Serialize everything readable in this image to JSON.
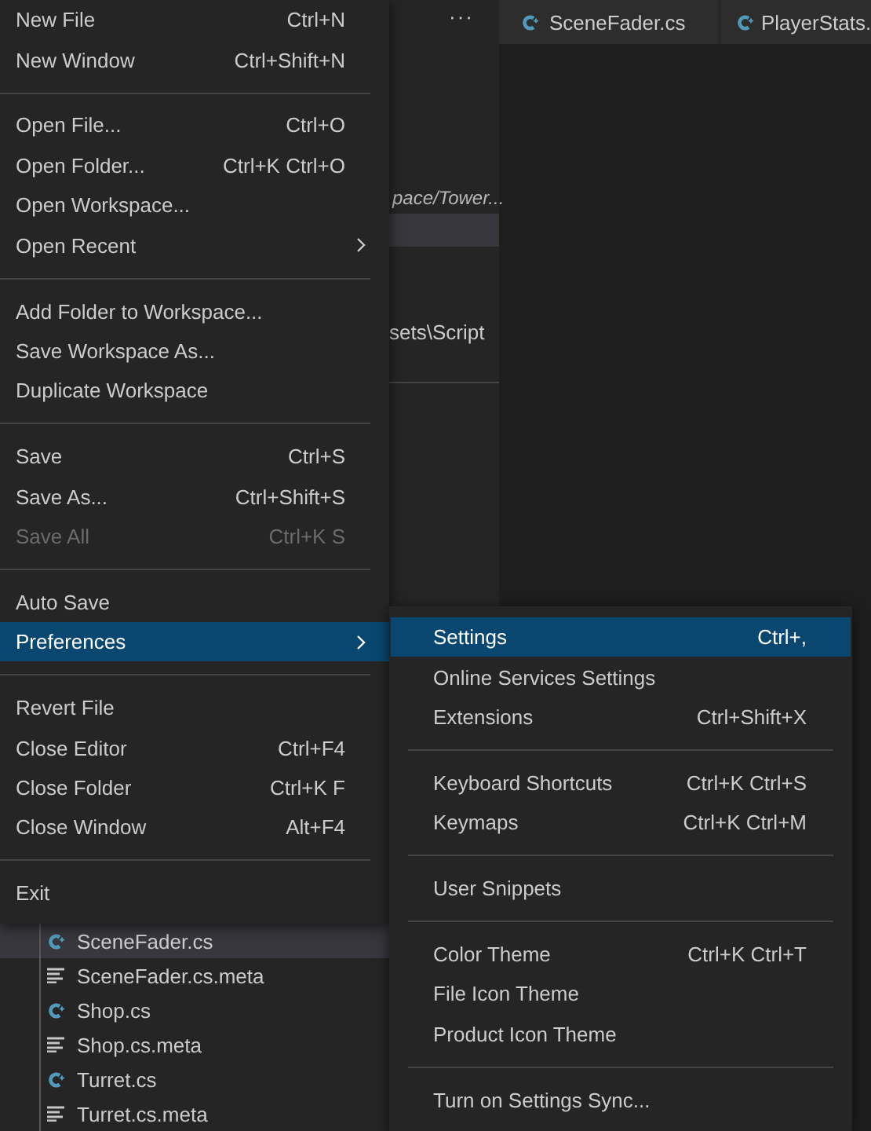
{
  "sidebar": {
    "more_actions": "···",
    "workspace_path": "pace/Tower...",
    "highlighted_row": {
      "selected": true
    },
    "folder_path": "sets\\Script",
    "files": [
      {
        "name": "SceneFader.cs",
        "kind": "csharp",
        "selected": true
      },
      {
        "name": "SceneFader.cs.meta",
        "kind": "meta",
        "selected": false
      },
      {
        "name": "Shop.cs",
        "kind": "csharp",
        "selected": false
      },
      {
        "name": "Shop.cs.meta",
        "kind": "meta",
        "selected": false
      },
      {
        "name": "Turret.cs",
        "kind": "csharp",
        "selected": false
      },
      {
        "name": "Turret.cs.meta",
        "kind": "meta",
        "selected": false
      }
    ]
  },
  "editor": {
    "tabs": [
      {
        "label": "SceneFader.cs",
        "kind": "csharp"
      },
      {
        "label": "PlayerStats.",
        "kind": "csharp"
      }
    ]
  },
  "file_menu": {
    "items": [
      {
        "kind": "item",
        "label": "New File",
        "shortcut": "Ctrl+N",
        "submenu": false,
        "disabled": false,
        "selected": false
      },
      {
        "kind": "item",
        "label": "New Window",
        "shortcut": "Ctrl+Shift+N",
        "submenu": false,
        "disabled": false,
        "selected": false
      },
      {
        "kind": "separator"
      },
      {
        "kind": "item",
        "label": "Open File...",
        "shortcut": "Ctrl+O",
        "submenu": false,
        "disabled": false,
        "selected": false
      },
      {
        "kind": "item",
        "label": "Open Folder...",
        "shortcut": "Ctrl+K Ctrl+O",
        "submenu": false,
        "disabled": false,
        "selected": false
      },
      {
        "kind": "item",
        "label": "Open Workspace...",
        "submenu": false,
        "disabled": false,
        "selected": false
      },
      {
        "kind": "item",
        "label": "Open Recent",
        "submenu": true,
        "disabled": false,
        "selected": false
      },
      {
        "kind": "separator"
      },
      {
        "kind": "item",
        "label": "Add Folder to Workspace...",
        "submenu": false,
        "disabled": false,
        "selected": false
      },
      {
        "kind": "item",
        "label": "Save Workspace As...",
        "submenu": false,
        "disabled": false,
        "selected": false
      },
      {
        "kind": "item",
        "label": "Duplicate Workspace",
        "submenu": false,
        "disabled": false,
        "selected": false
      },
      {
        "kind": "separator"
      },
      {
        "kind": "item",
        "label": "Save",
        "shortcut": "Ctrl+S",
        "submenu": false,
        "disabled": false,
        "selected": false
      },
      {
        "kind": "item",
        "label": "Save As...",
        "shortcut": "Ctrl+Shift+S",
        "submenu": false,
        "disabled": false,
        "selected": false
      },
      {
        "kind": "item",
        "label": "Save All",
        "shortcut": "Ctrl+K S",
        "submenu": false,
        "disabled": true,
        "selected": false
      },
      {
        "kind": "separator"
      },
      {
        "kind": "item",
        "label": "Auto Save",
        "submenu": false,
        "disabled": false,
        "selected": false
      },
      {
        "kind": "item",
        "label": "Preferences",
        "submenu": true,
        "disabled": false,
        "selected": true
      },
      {
        "kind": "separator"
      },
      {
        "kind": "item",
        "label": "Revert File",
        "submenu": false,
        "disabled": false,
        "selected": false
      },
      {
        "kind": "item",
        "label": "Close Editor",
        "shortcut": "Ctrl+F4",
        "submenu": false,
        "disabled": false,
        "selected": false
      },
      {
        "kind": "item",
        "label": "Close Folder",
        "shortcut": "Ctrl+K F",
        "submenu": false,
        "disabled": false,
        "selected": false
      },
      {
        "kind": "item",
        "label": "Close Window",
        "shortcut": "Alt+F4",
        "submenu": false,
        "disabled": false,
        "selected": false
      },
      {
        "kind": "separator"
      },
      {
        "kind": "item",
        "label": "Exit",
        "submenu": false,
        "disabled": false,
        "selected": false
      }
    ]
  },
  "preferences_menu": {
    "items": [
      {
        "kind": "item",
        "label": "Settings",
        "shortcut": "Ctrl+,",
        "disabled": false,
        "selected": true
      },
      {
        "kind": "item",
        "label": "Online Services Settings",
        "disabled": false,
        "selected": false
      },
      {
        "kind": "item",
        "label": "Extensions",
        "shortcut": "Ctrl+Shift+X",
        "disabled": false,
        "selected": false
      },
      {
        "kind": "separator"
      },
      {
        "kind": "item",
        "label": "Keyboard Shortcuts",
        "shortcut": "Ctrl+K Ctrl+S",
        "disabled": false,
        "selected": false
      },
      {
        "kind": "item",
        "label": "Keymaps",
        "shortcut": "Ctrl+K Ctrl+M",
        "disabled": false,
        "selected": false
      },
      {
        "kind": "separator"
      },
      {
        "kind": "item",
        "label": "User Snippets",
        "disabled": false,
        "selected": false
      },
      {
        "kind": "separator"
      },
      {
        "kind": "item",
        "label": "Color Theme",
        "shortcut": "Ctrl+K Ctrl+T",
        "disabled": false,
        "selected": false
      },
      {
        "kind": "item",
        "label": "File Icon Theme",
        "disabled": false,
        "selected": false
      },
      {
        "kind": "item",
        "label": "Product Icon Theme",
        "disabled": false,
        "selected": false
      },
      {
        "kind": "separator"
      },
      {
        "kind": "item",
        "label": "Turn on Settings Sync...",
        "disabled": false,
        "selected": false
      }
    ]
  }
}
